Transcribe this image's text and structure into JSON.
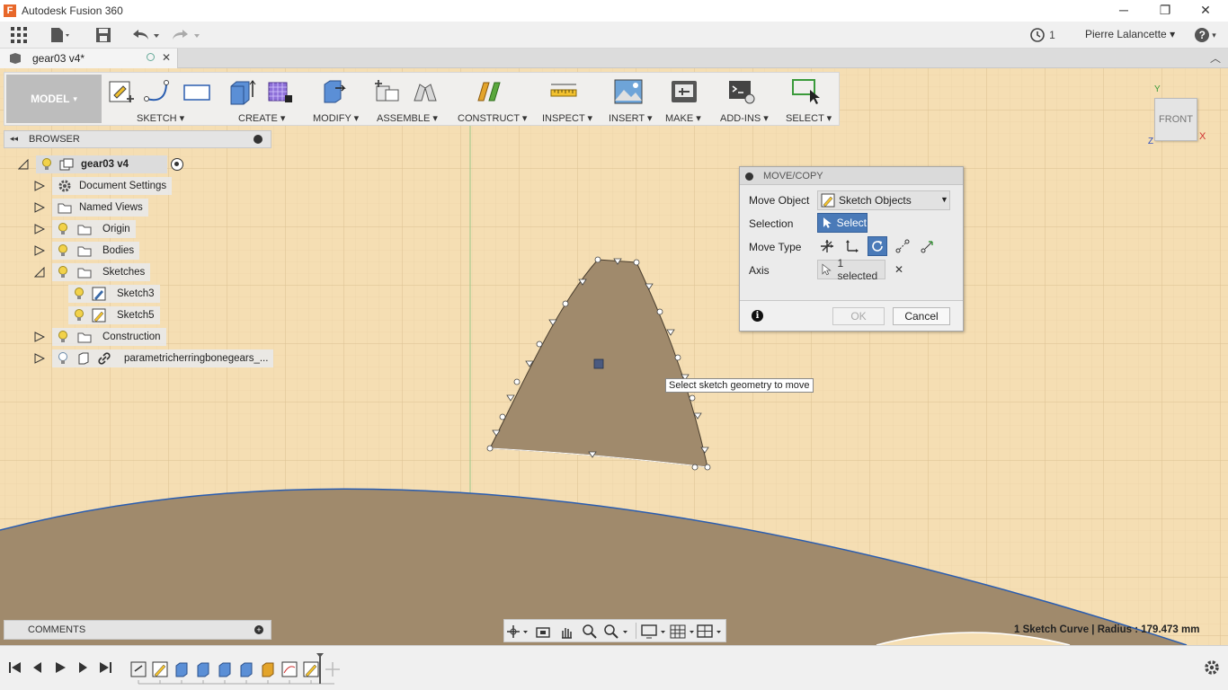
{
  "window": {
    "title": "Autodesk Fusion 360",
    "app_logo": "F",
    "controls": {
      "minimize": "─",
      "restore": "❐",
      "close": "✕"
    }
  },
  "quick_access": {
    "job_count": "1",
    "user_name": "Pierre Lalancette",
    "user_caret": "▾",
    "help_icon": "?"
  },
  "document_tab": {
    "label": "gear03 v4*"
  },
  "ribbon": {
    "workspace": "MODEL",
    "workspace_caret": "▾",
    "groups": [
      {
        "id": "sketch",
        "label": "SKETCH"
      },
      {
        "id": "create",
        "label": "CREATE"
      },
      {
        "id": "modify",
        "label": "MODIFY"
      },
      {
        "id": "assemble",
        "label": "ASSEMBLE"
      },
      {
        "id": "construct",
        "label": "CONSTRUCT"
      },
      {
        "id": "inspect",
        "label": "INSPECT"
      },
      {
        "id": "insert",
        "label": "INSERT"
      },
      {
        "id": "make",
        "label": "MAKE"
      },
      {
        "id": "addins",
        "label": "ADD-INS"
      },
      {
        "id": "select",
        "label": "SELECT"
      }
    ]
  },
  "browser": {
    "title": "BROWSER",
    "collapse_icon": "◂◂",
    "items": [
      {
        "label": "gear03 v4"
      },
      {
        "label": "Document Settings"
      },
      {
        "label": "Named Views"
      },
      {
        "label": "Origin"
      },
      {
        "label": "Bodies"
      },
      {
        "label": "Sketches"
      },
      {
        "label": "Sketch3"
      },
      {
        "label": "Sketch5"
      },
      {
        "label": "Construction"
      },
      {
        "label": "parametricherringbonegears_..."
      }
    ]
  },
  "dialog": {
    "title": "MOVE/COPY",
    "move_object_label": "Move Object",
    "move_object_value": "Sketch Objects",
    "selection_label": "Selection",
    "selection_button": "Select",
    "move_type_label": "Move Type",
    "axis_label": "Axis",
    "axis_value": "1 selected",
    "axis_clear": "✕",
    "info_icon": "i",
    "ok_label": "OK",
    "cancel_label": "Cancel"
  },
  "tooltip": "Select sketch geometry to move",
  "viewcube": {
    "face": "FRONT",
    "axis_x": "X",
    "axis_y": "Y",
    "axis_z": "Z"
  },
  "comments": {
    "title": "COMMENTS"
  },
  "status": "1 Sketch Curve | Radius : 179.473 mm",
  "colors": {
    "canvas": "#f5deb3",
    "body": "#a08a6c",
    "edge": "#2a5db0",
    "accent": "#4a7ab8"
  }
}
